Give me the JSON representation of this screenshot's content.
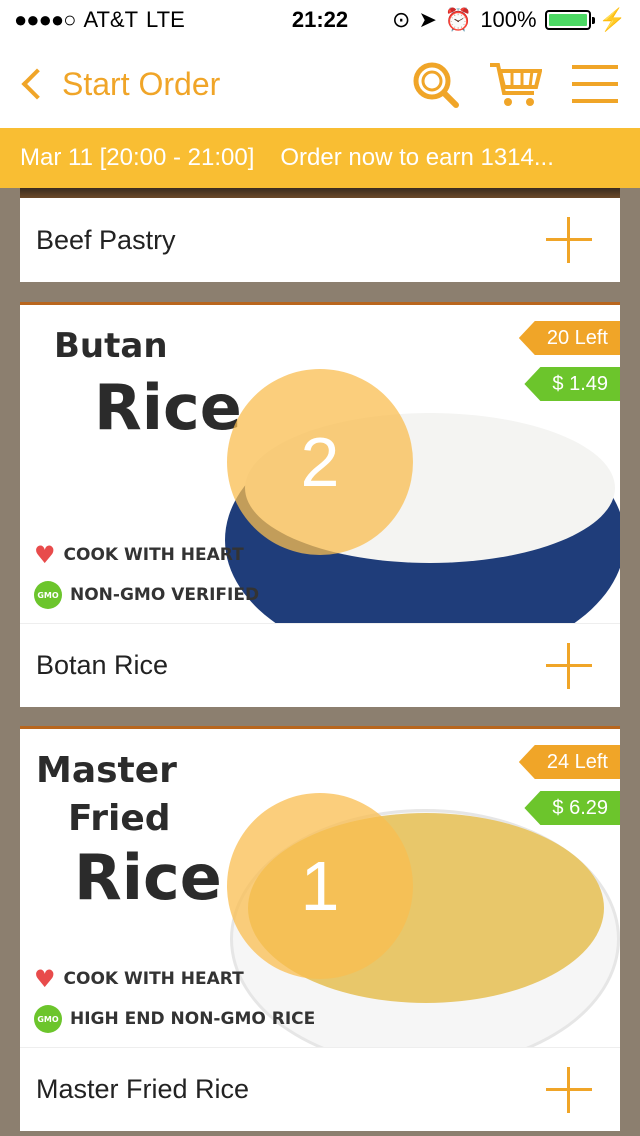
{
  "status": {
    "carrier": "AT&T",
    "network": "LTE",
    "time": "21:22",
    "battery": "100%"
  },
  "nav": {
    "back_label": "Start Order"
  },
  "banner": {
    "slot": "Mar 11 [20:00 - 21:00]",
    "message": "Order now to earn 1314..."
  },
  "items": [
    {
      "name": "Beef Pastry"
    },
    {
      "name": "Botan Rice",
      "title_line1": "Butan",
      "title_line2": "Rice",
      "stock": "20 Left",
      "price": "$ 1.49",
      "count": "2",
      "claim1": "COOK WITH HEART",
      "claim2": "NON-GMO VERIFIED"
    },
    {
      "name": "Master Fried Rice",
      "title_line1": "Master",
      "title_line2": "Fried",
      "title_line3": "Rice",
      "stock": "24 Left",
      "price": "$ 6.29",
      "count": "1",
      "claim1": "COOK WITH HEART",
      "claim2": "HIGH END NON-GMO RICE"
    }
  ],
  "colors": {
    "accent": "#f0a528",
    "banner": "#f9be33",
    "price": "#6cc52c"
  }
}
